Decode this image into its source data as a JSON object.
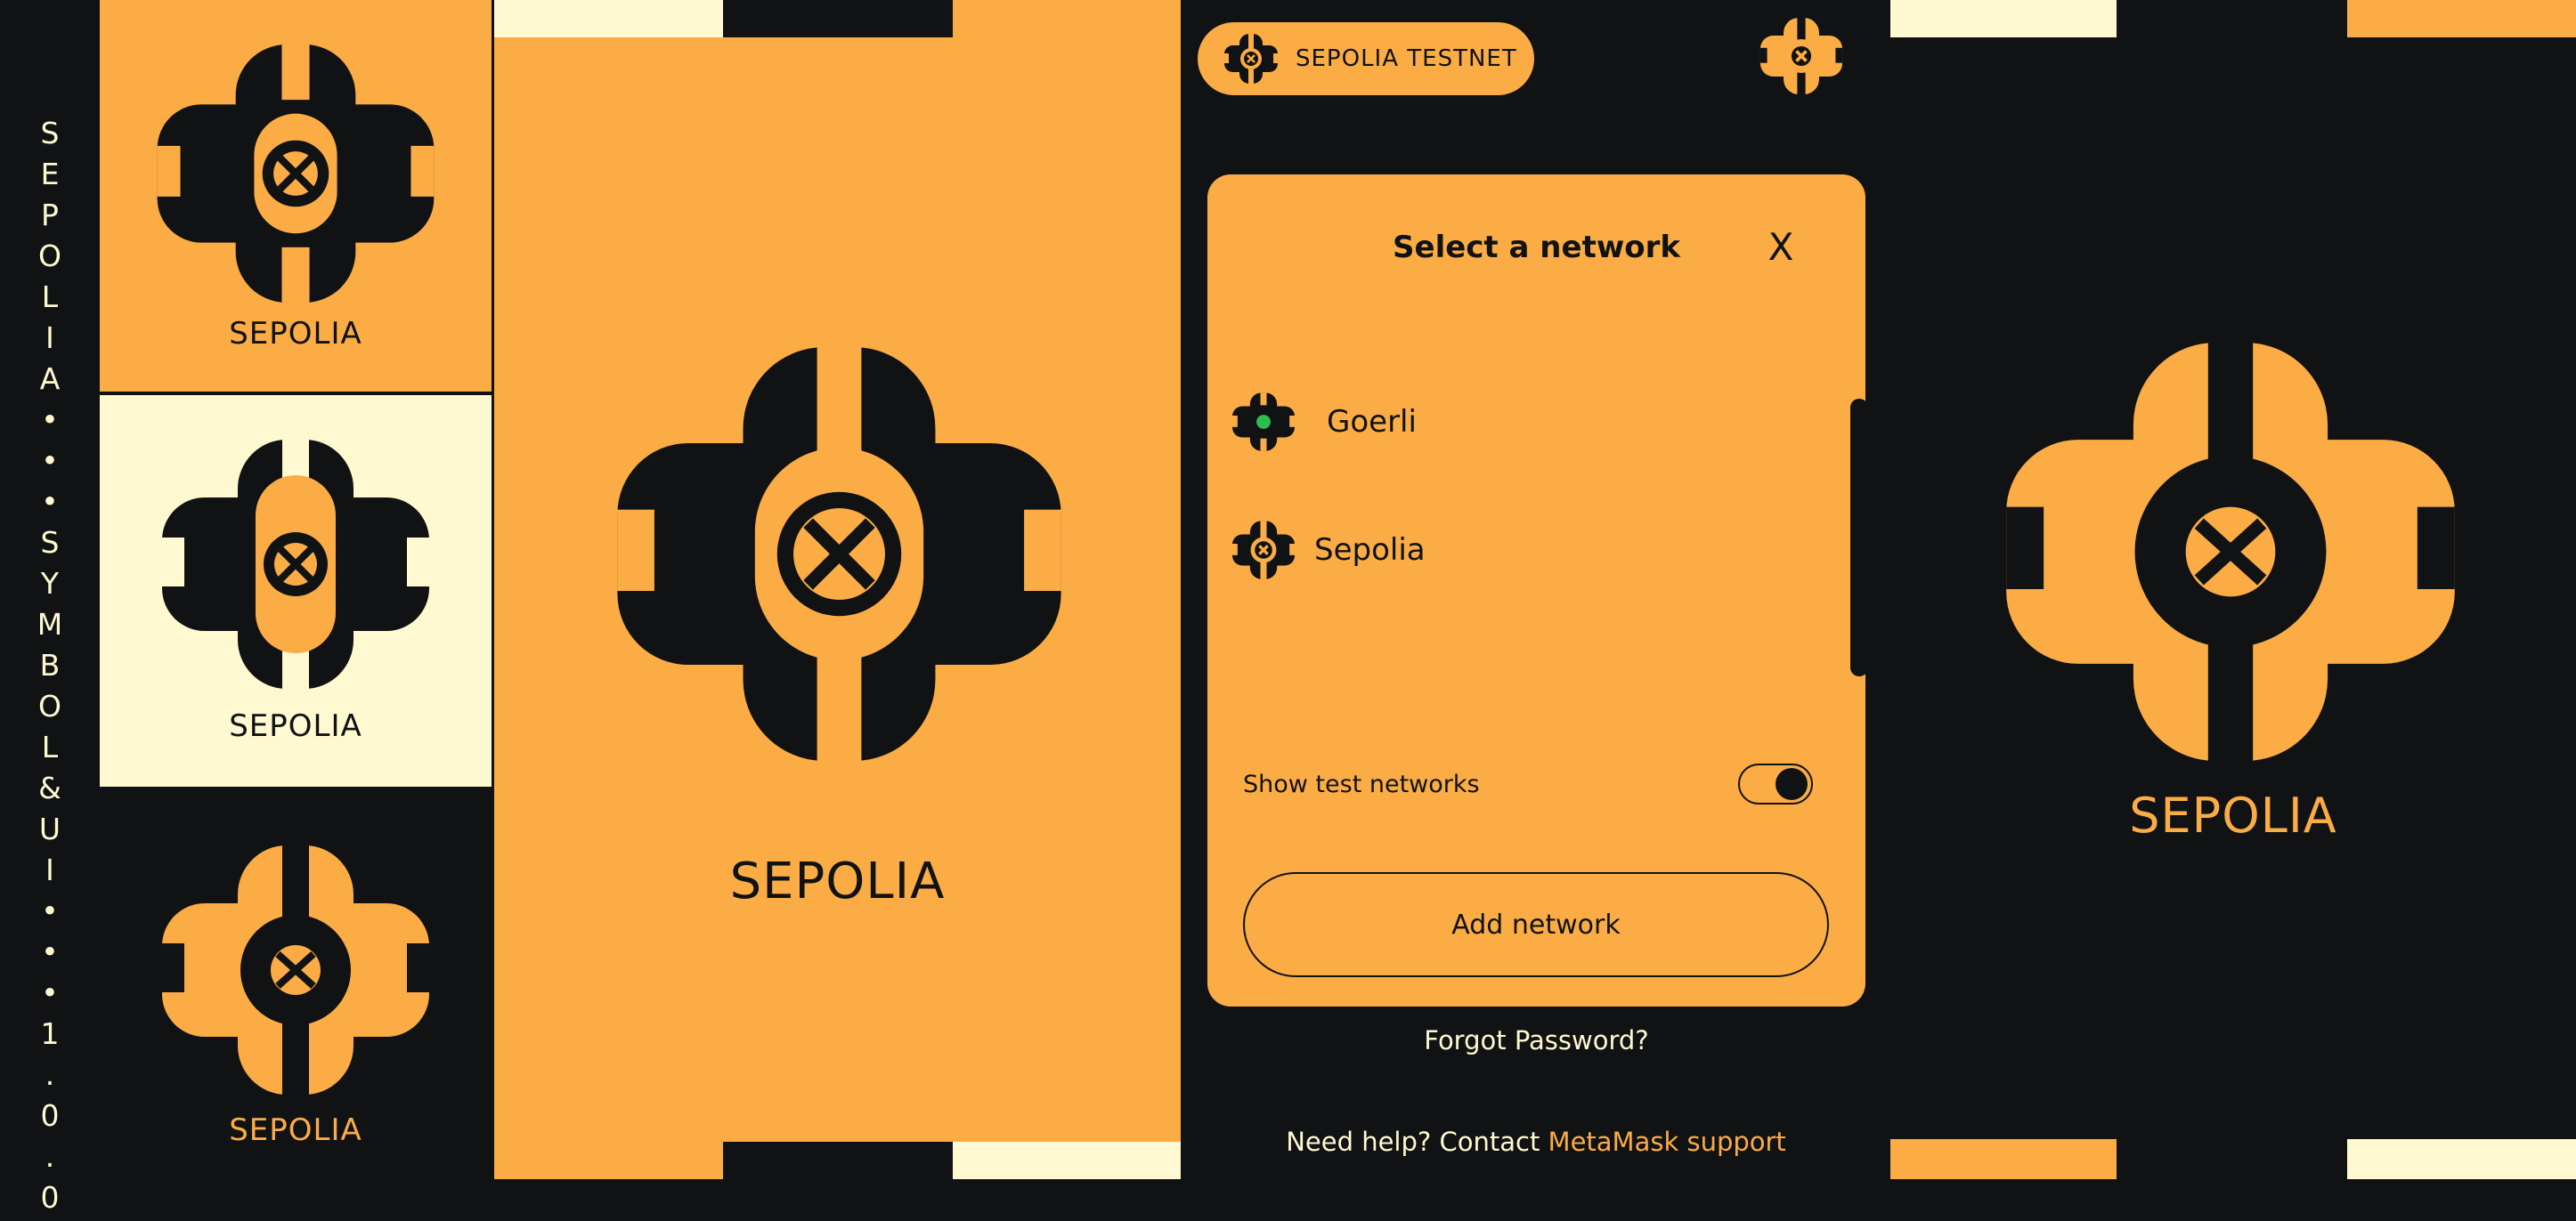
{
  "side_label": "SEPOLIA•••SYMBOL&UI•••1.0.0",
  "tiles": {
    "tile1_caption": "SEPOLIA",
    "tile2_caption": "SEPOLIA",
    "tile3_caption": "SEPOLIA",
    "hero_caption": "SEPOLIA",
    "right_caption": "SEPOLIA"
  },
  "network_pill": {
    "label": "SEPOLIA TESTNET",
    "icon": "sepolia-logo-icon"
  },
  "modal": {
    "title": "Select a network",
    "close_label": "X",
    "networks": [
      {
        "label": "Goerli",
        "icon": "goerli-logo-icon",
        "status_color": "#2DBE4E"
      },
      {
        "label": "Sepolia",
        "icon": "sepolia-logo-icon"
      }
    ],
    "toggle": {
      "label": "Show test networks",
      "on": true
    },
    "add_network_label": "Add network"
  },
  "forgot_password": "Forgot Password?",
  "help": {
    "prefix": "Need help? Contact ",
    "link": "MetaMask support"
  },
  "colors": {
    "orange": "#FBAC45",
    "dark": "#101214",
    "cream": "#FFF9D1",
    "green": "#2DBE4E"
  }
}
